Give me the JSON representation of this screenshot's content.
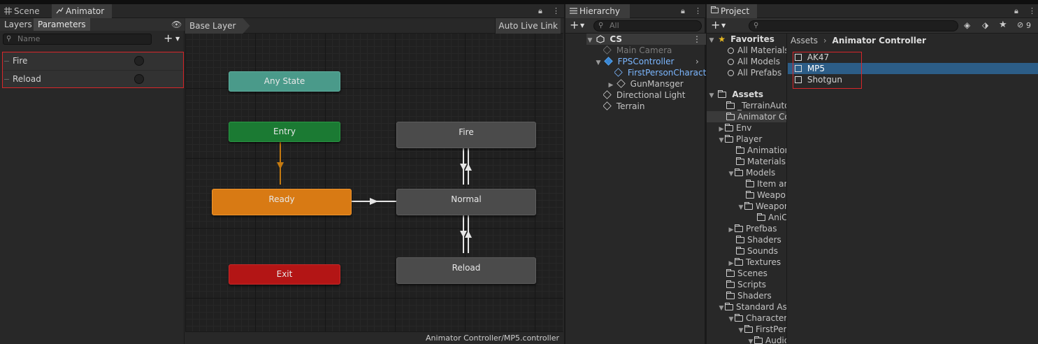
{
  "animator_panel": {
    "tabs": [
      {
        "label": "Scene"
      },
      {
        "label": "Animator"
      }
    ],
    "subtabs": {
      "layers": "Layers",
      "parameters": "Parameters"
    },
    "search_placeholder": "Name",
    "parameters": [
      {
        "name": "Fire"
      },
      {
        "name": "Reload"
      }
    ]
  },
  "graph": {
    "breadcrumb": "Base Layer",
    "auto_live_link": "Auto Live Link",
    "status_path": "Animator Controller/MP5.controller",
    "states": {
      "any_state": "Any State",
      "entry": "Entry",
      "ready": "Ready",
      "exit": "Exit",
      "fire": "Fire",
      "normal": "Normal",
      "reload": "Reload"
    },
    "colors": {
      "any_state": "#4a9a8a",
      "entry": "#1b7a33",
      "ready": "#d87a14",
      "exit": "#b31515",
      "default_state": "#4b4b4b"
    }
  },
  "hierarchy": {
    "title": "Hierarchy",
    "search_placeholder": "All",
    "items": [
      {
        "label": "CS"
      },
      {
        "label": "Main Camera"
      },
      {
        "label": "FPSController"
      },
      {
        "label": "FirstPersonCharacter"
      },
      {
        "label": "GunMansger"
      },
      {
        "label": "Directional Light"
      },
      {
        "label": "Terrain"
      }
    ]
  },
  "project": {
    "title": "Project",
    "hidden_count": "9",
    "tree": {
      "favorites": "Favorites",
      "fav_items": [
        "All Materials",
        "All Models",
        "All Prefabs"
      ],
      "assets": "Assets",
      "folders": [
        "_TerrainAutoUpgrade",
        "Animator Controller",
        "Env",
        "Player",
        "Animations",
        "Materials",
        "Models",
        "Item and",
        "Weapons",
        "Weapons",
        "AniClips",
        "Prefbas",
        "Shaders",
        "Sounds",
        "Textures",
        "Scenes",
        "Scripts",
        "Shaders",
        "Standard Assets",
        "Characters",
        "FirstPerson",
        "Audio"
      ]
    },
    "breadcrumb": {
      "root": "Assets",
      "current": "Animator Controller"
    },
    "assets": [
      {
        "name": "AK47"
      },
      {
        "name": "MP5"
      },
      {
        "name": "Shotgun"
      }
    ],
    "selected_asset": "MP5"
  }
}
